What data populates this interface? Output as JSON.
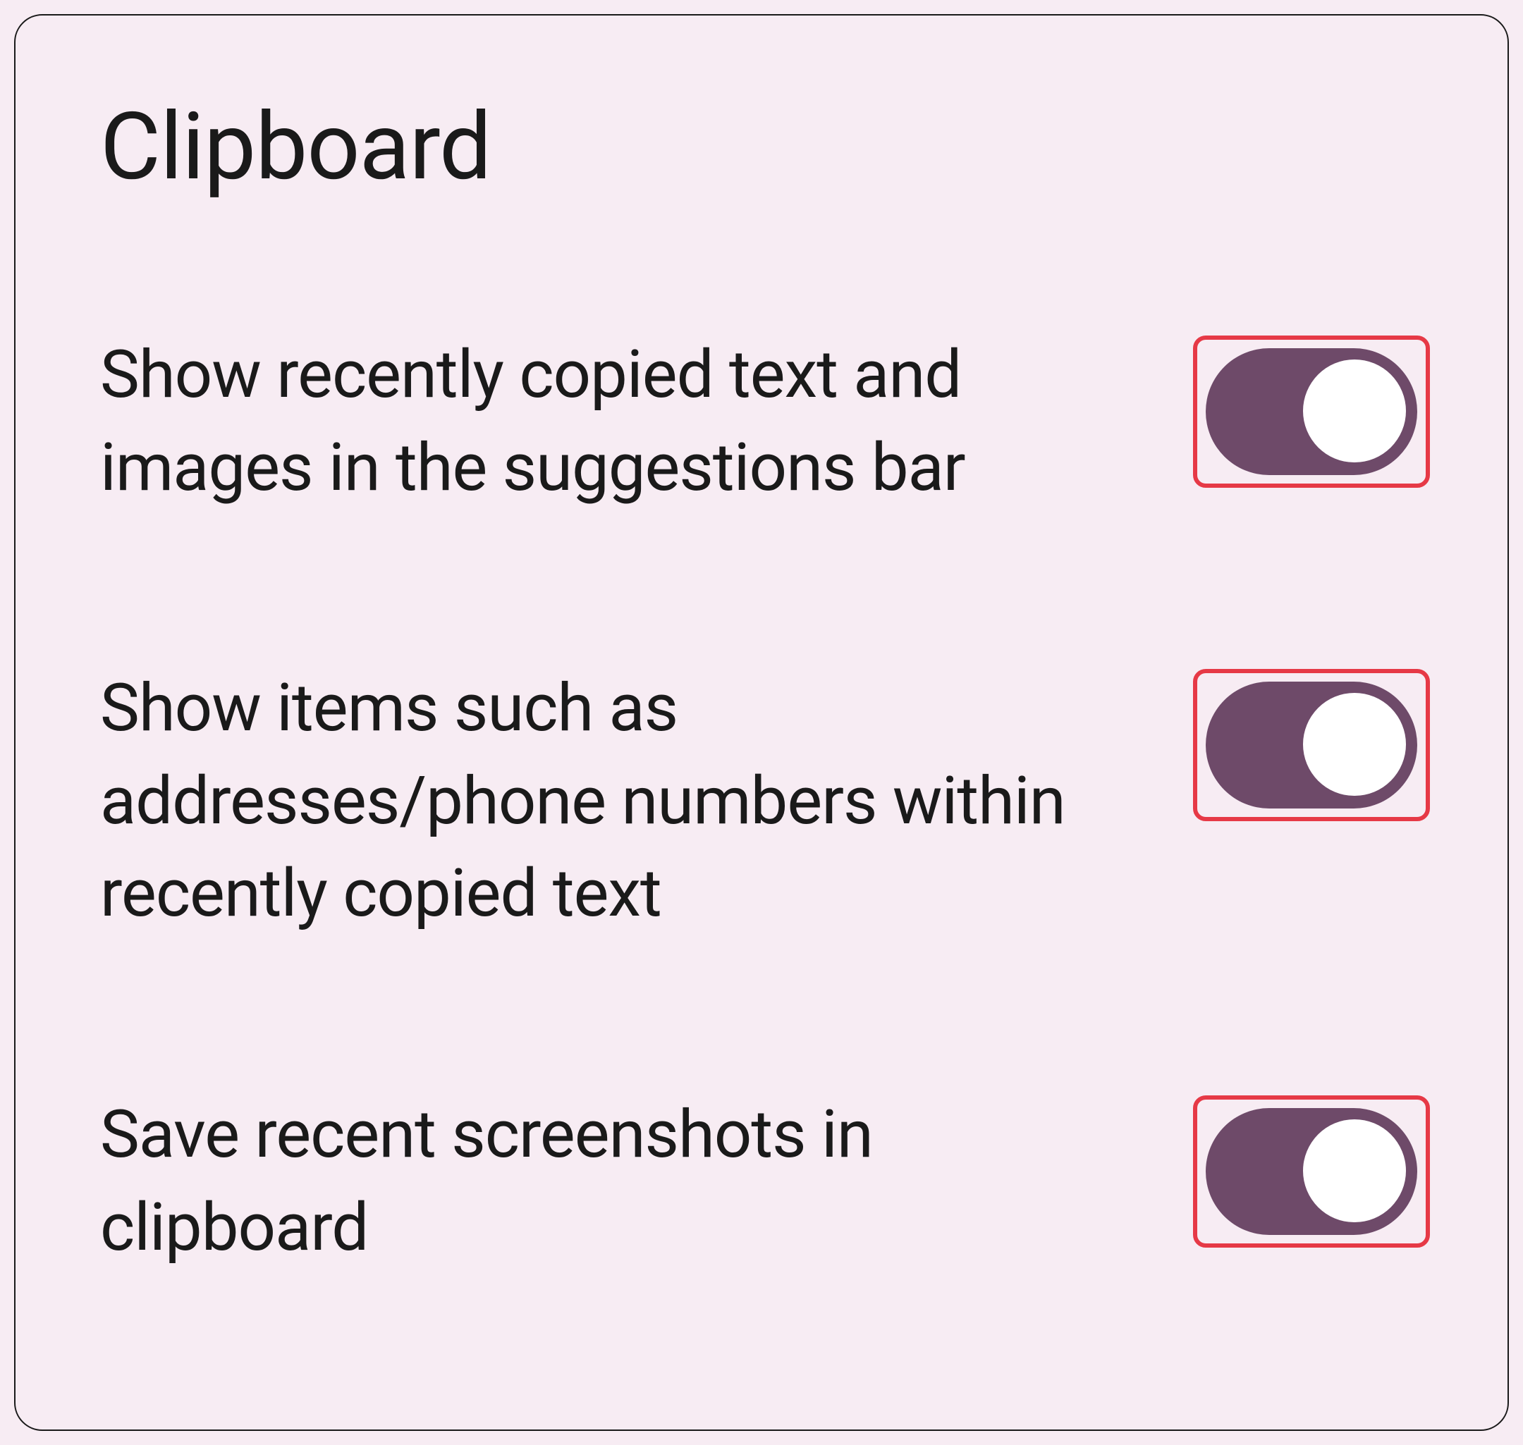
{
  "page": {
    "title": "Clipboard"
  },
  "settings": [
    {
      "id": "show-recent-suggestions",
      "label": "Show recently copied text and images in the suggestions bar",
      "enabled": true
    },
    {
      "id": "show-structured-items",
      "label": "Show items such as addresses/phone numbers within recently copied text",
      "enabled": true
    },
    {
      "id": "save-screenshots",
      "label": "Save recent screenshots in clipboard",
      "enabled": true
    }
  ],
  "colors": {
    "background": "#f7ecf3",
    "text": "#1a1a1a",
    "toggleTrack": "#6e4a69",
    "toggleThumb": "#ffffff",
    "highlight": "#e63946"
  }
}
